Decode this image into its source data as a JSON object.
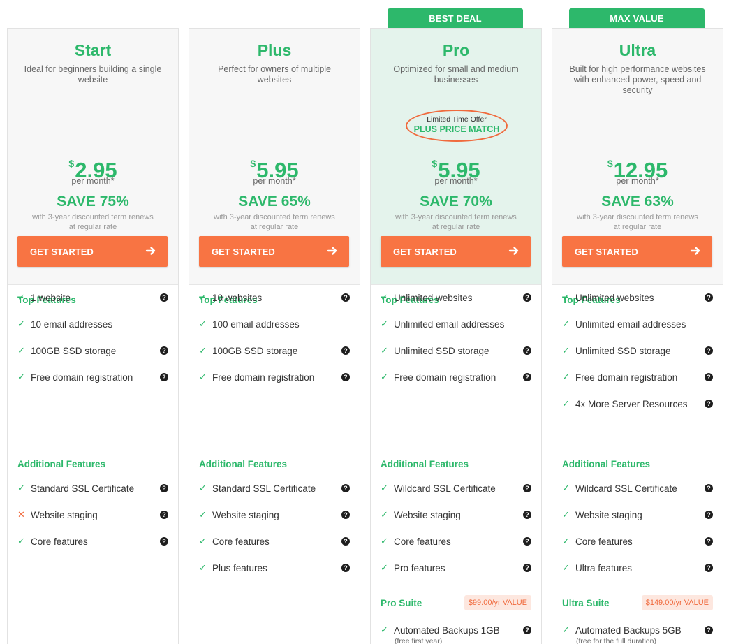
{
  "badges": {
    "pro": "BEST DEAL",
    "ultra": "MAX VALUE"
  },
  "common": {
    "cta_label": "GET STARTED",
    "per_month": "per month*",
    "save_note": "with 3-year discounted term renews at regular rate",
    "top_features_title": "Top Features",
    "additional_features_title": "Additional Features",
    "help_icon": "question-circle-icon",
    "check_icon": "check-icon",
    "cross_icon": "cross-icon"
  },
  "colors": {
    "accent_green": "#2db86b",
    "cta_orange": "#f87443",
    "offer_ring": "#f06a3d",
    "pro_highlight": "#e4f3ec"
  },
  "plans": [
    {
      "name": "Start",
      "description": "Ideal for beginners building a single website",
      "currency": "$",
      "price": "2.95",
      "save": "SAVE 75%",
      "top_features": [
        {
          "label": "1 website",
          "mark": "check",
          "help": true
        },
        {
          "label": "10 email addresses",
          "mark": "check",
          "help": false
        },
        {
          "label": "100GB SSD storage",
          "mark": "check",
          "help": true
        },
        {
          "label": "Free domain registration",
          "mark": "check",
          "help": true
        }
      ],
      "additional_features": [
        {
          "label": "Standard SSL Certificate",
          "mark": "check",
          "help": true
        },
        {
          "label": "Website staging",
          "mark": "cross",
          "help": true
        },
        {
          "label": "Core features",
          "mark": "check",
          "help": true
        }
      ]
    },
    {
      "name": "Plus",
      "description": "Perfect for owners of multiple websites",
      "currency": "$",
      "price": "5.95",
      "save": "SAVE 65%",
      "top_features": [
        {
          "label": "10 websites",
          "mark": "check",
          "help": true
        },
        {
          "label": "100 email addresses",
          "mark": "check",
          "help": false
        },
        {
          "label": "100GB SSD storage",
          "mark": "check",
          "help": true
        },
        {
          "label": "Free domain registration",
          "mark": "check",
          "help": true
        }
      ],
      "additional_features": [
        {
          "label": "Standard SSL Certificate",
          "mark": "check",
          "help": true
        },
        {
          "label": "Website staging",
          "mark": "check",
          "help": true
        },
        {
          "label": "Core features",
          "mark": "check",
          "help": true
        },
        {
          "label": "Plus features",
          "mark": "check",
          "help": true
        }
      ]
    },
    {
      "name": "Pro",
      "description": "Optimized for small and medium businesses",
      "offer_top": "Limited Time Offer",
      "offer_bottom": "PLUS PRICE MATCH",
      "currency": "$",
      "price": "5.95",
      "save": "SAVE 70%",
      "top_features": [
        {
          "label": "Unlimited websites",
          "mark": "check",
          "help": true
        },
        {
          "label": "Unlimited email addresses",
          "mark": "check",
          "help": false
        },
        {
          "label": "Unlimited SSD storage",
          "mark": "check",
          "help": true
        },
        {
          "label": "Free domain registration",
          "mark": "check",
          "help": true
        }
      ],
      "additional_features": [
        {
          "label": "Wildcard SSL Certificate",
          "mark": "check",
          "help": true
        },
        {
          "label": "Website staging",
          "mark": "check",
          "help": true
        },
        {
          "label": "Core features",
          "mark": "check",
          "help": true
        },
        {
          "label": "Pro features",
          "mark": "check",
          "help": true
        }
      ],
      "suite": {
        "title": "Pro Suite",
        "value": "$99.00/yr VALUE",
        "item": "Automated Backups 1GB",
        "item_note": "(free first year)"
      }
    },
    {
      "name": "Ultra",
      "description": "Built for high performance websites with enhanced power, speed and security",
      "currency": "$",
      "price": "12.95",
      "save": "SAVE 63%",
      "top_features": [
        {
          "label": "Unlimited websites",
          "mark": "check",
          "help": true
        },
        {
          "label": "Unlimited email addresses",
          "mark": "check",
          "help": false
        },
        {
          "label": "Unlimited SSD storage",
          "mark": "check",
          "help": true
        },
        {
          "label": "Free domain registration",
          "mark": "check",
          "help": true
        },
        {
          "label": "4x More Server Resources",
          "mark": "check",
          "help": true
        }
      ],
      "additional_features": [
        {
          "label": "Wildcard SSL Certificate",
          "mark": "check",
          "help": true
        },
        {
          "label": "Website staging",
          "mark": "check",
          "help": true
        },
        {
          "label": "Core features",
          "mark": "check",
          "help": true
        },
        {
          "label": "Ultra features",
          "mark": "check",
          "help": true
        }
      ],
      "suite": {
        "title": "Ultra Suite",
        "value": "$149.00/yr VALUE",
        "item": "Automated Backups 5GB",
        "item_note": "(free for the full duration)"
      }
    }
  ]
}
